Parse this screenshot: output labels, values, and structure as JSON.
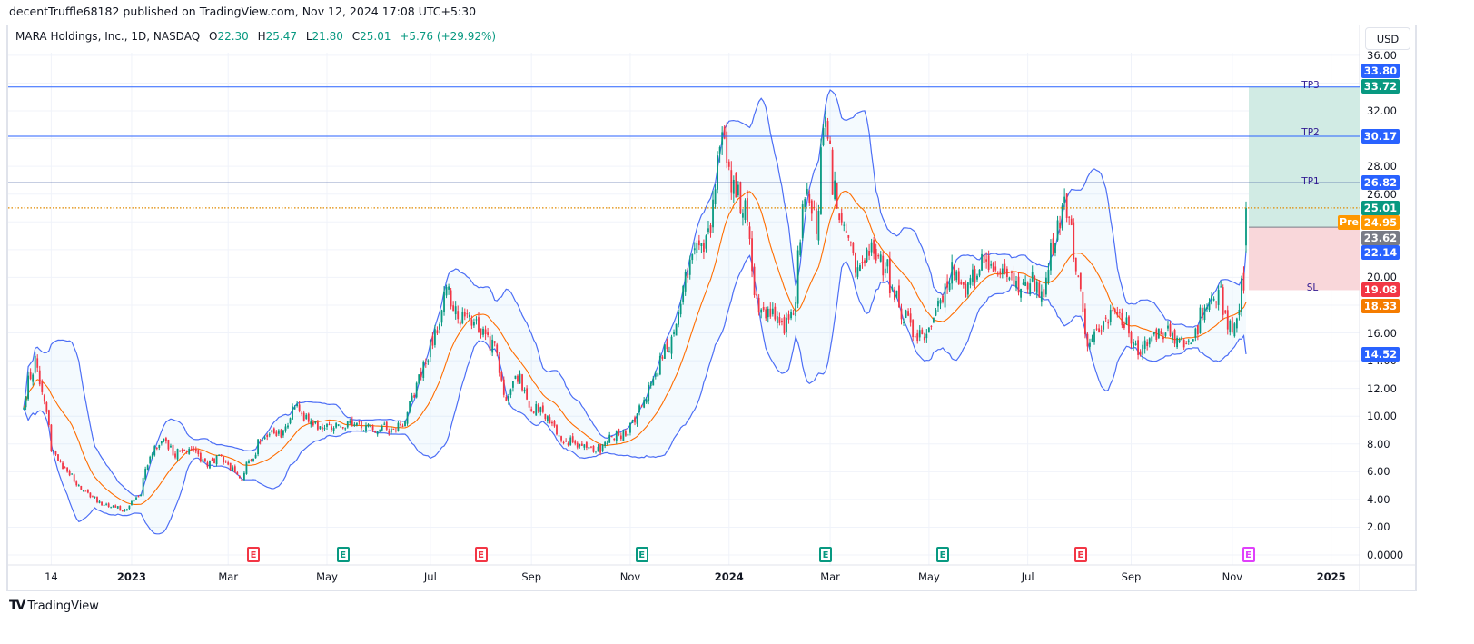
{
  "published": "decentTruffle68182 published on TradingView.com, Nov 12, 2024 17:08 UTC+5:30",
  "legend": {
    "symbol": "MARA Holdings, Inc., 1D, NASDAQ",
    "open_label": "O",
    "open": "22.30",
    "high_label": "H",
    "high": "25.47",
    "low_label": "L",
    "low": "21.80",
    "close_label": "C",
    "close": "25.01",
    "change": "+5.76 (+29.92%)"
  },
  "currency_button": "USD",
  "footer_logo": "TradingView",
  "colors": {
    "up": "#089981",
    "down": "#f23645",
    "bb_band": "#4c6ef5",
    "bb_basis": "#ff6d00",
    "target_zone": "#d1ebe4",
    "stop_zone": "#f9d7da",
    "level_line": "#2962ff"
  },
  "price_labels": [
    {
      "value": "33.80",
      "color": "#2962ff"
    },
    {
      "value": "33.72",
      "color": "#089981"
    },
    {
      "value": "30.17",
      "color": "#2962ff"
    },
    {
      "value": "26.82",
      "color": "#2962ff"
    },
    {
      "value": "25.01",
      "color": "#089981"
    },
    {
      "value": "24.95",
      "color": "#ff9800"
    },
    {
      "value": "23.62",
      "color": "#787b86"
    },
    {
      "value": "22.14",
      "color": "#2962ff"
    },
    {
      "value": "19.08",
      "color": "#f23645"
    },
    {
      "value": "18.33",
      "color": "#f57c00"
    },
    {
      "value": "14.52",
      "color": "#2962ff"
    }
  ],
  "pre_label": "Pre",
  "position_tool": {
    "entry": 23.62,
    "target": 33.72,
    "stop": 19.08,
    "stop_label": "SL"
  },
  "levels": [
    {
      "label": "TP3",
      "price": 33.72
    },
    {
      "label": "TP2",
      "price": 30.17
    },
    {
      "label": "TP1",
      "price": 26.82
    }
  ],
  "last_price_line": 25.01,
  "earnings": [
    {
      "label": "E",
      "date": "2023-03-16",
      "status": "miss"
    },
    {
      "label": "E",
      "date": "2023-05-10",
      "status": "beat"
    },
    {
      "label": "E",
      "date": "2023-08-02",
      "status": "miss"
    },
    {
      "label": "E",
      "date": "2023-11-08",
      "status": "beat"
    },
    {
      "label": "E",
      "date": "2024-02-28",
      "status": "beat"
    },
    {
      "label": "E",
      "date": "2024-05-09",
      "status": "beat"
    },
    {
      "label": "E",
      "date": "2024-08-01",
      "status": "miss"
    },
    {
      "label": "E",
      "date": "2024-11-12",
      "status": "upcoming"
    }
  ],
  "chart_data": {
    "type": "candlestick",
    "title": "MARA Holdings, Inc., 1D, NASDAQ",
    "indicators": [
      "Bollinger Bands (20, 2)"
    ],
    "y_axis": {
      "min": 0,
      "max": 36,
      "position": "right",
      "ticks": [
        "36.00",
        "32.00",
        "28.00",
        "26.00",
        "20.00",
        "16.00",
        "14.00",
        "12.00",
        "10.00",
        "8.00",
        "6.00",
        "4.00",
        "2.00",
        "0.0000"
      ]
    },
    "x_axis": {
      "ticks": [
        {
          "label": "14",
          "date": "2022-11-14"
        },
        {
          "label": "2023",
          "date": "2023-01-02"
        },
        {
          "label": "Mar",
          "date": "2023-03-01"
        },
        {
          "label": "May",
          "date": "2023-05-01"
        },
        {
          "label": "Jul",
          "date": "2023-07-03"
        },
        {
          "label": "Sep",
          "date": "2023-09-01"
        },
        {
          "label": "Nov",
          "date": "2023-11-01"
        },
        {
          "label": "2024",
          "date": "2024-01-01"
        },
        {
          "label": "Mar",
          "date": "2024-03-01"
        },
        {
          "label": "May",
          "date": "2024-05-01"
        },
        {
          "label": "Jul",
          "date": "2024-07-01"
        },
        {
          "label": "Sep",
          "date": "2024-09-02"
        },
        {
          "label": "Nov",
          "date": "2024-11-01"
        },
        {
          "label": "2025",
          "date": "2025-01-01"
        }
      ]
    },
    "grid": true,
    "approx_closes": [
      [
        "2022-10-27",
        10.5
      ],
      [
        "2022-11-03",
        14.0
      ],
      [
        "2022-11-08",
        11.5
      ],
      [
        "2022-11-14",
        7.5
      ],
      [
        "2022-11-22",
        6.2
      ],
      [
        "2022-12-01",
        4.8
      ],
      [
        "2022-12-12",
        3.8
      ],
      [
        "2022-12-28",
        3.2
      ],
      [
        "2023-01-06",
        4.5
      ],
      [
        "2023-01-13",
        7.5
      ],
      [
        "2023-01-20",
        8.3
      ],
      [
        "2023-01-27",
        7.3
      ],
      [
        "2023-02-06",
        7.8
      ],
      [
        "2023-02-16",
        6.5
      ],
      [
        "2023-02-24",
        7.0
      ],
      [
        "2023-03-09",
        5.5
      ],
      [
        "2023-03-16",
        7.2
      ],
      [
        "2023-03-23",
        8.8
      ],
      [
        "2023-04-03",
        8.6
      ],
      [
        "2023-04-12",
        11.0
      ],
      [
        "2023-04-19",
        9.5
      ],
      [
        "2023-04-27",
        9.2
      ],
      [
        "2023-05-10",
        9.4
      ],
      [
        "2023-05-25",
        9.2
      ],
      [
        "2023-06-07",
        9.1
      ],
      [
        "2023-06-15",
        9.4
      ],
      [
        "2023-06-23",
        12.0
      ],
      [
        "2023-07-03",
        15.0
      ],
      [
        "2023-07-12",
        19.0
      ],
      [
        "2023-07-20",
        17.0
      ],
      [
        "2023-08-01",
        16.5
      ],
      [
        "2023-08-10",
        15.0
      ],
      [
        "2023-08-17",
        11.0
      ],
      [
        "2023-08-25",
        13.0
      ],
      [
        "2023-08-31",
        10.7
      ],
      [
        "2023-09-08",
        10.3
      ],
      [
        "2023-09-20",
        8.5
      ],
      [
        "2023-10-02",
        7.8
      ],
      [
        "2023-10-12",
        7.5
      ],
      [
        "2023-10-20",
        8.5
      ],
      [
        "2023-10-30",
        8.8
      ],
      [
        "2023-11-08",
        11.0
      ],
      [
        "2023-11-16",
        13.0
      ],
      [
        "2023-11-27",
        16.0
      ],
      [
        "2023-12-05",
        20.0
      ],
      [
        "2023-12-14",
        22.5
      ],
      [
        "2023-12-20",
        24.0
      ],
      [
        "2023-12-27",
        30.0
      ],
      [
        "2024-01-03",
        26.0
      ],
      [
        "2024-01-10",
        25.0
      ],
      [
        "2024-01-17",
        18.0
      ],
      [
        "2024-01-24",
        17.5
      ],
      [
        "2024-02-01",
        16.5
      ],
      [
        "2024-02-08",
        17.0
      ],
      [
        "2024-02-15",
        26.0
      ],
      [
        "2024-02-22",
        24.0
      ],
      [
        "2024-02-28",
        31.0
      ],
      [
        "2024-03-05",
        26.0
      ],
      [
        "2024-03-12",
        23.0
      ],
      [
        "2024-03-19",
        20.0
      ],
      [
        "2024-03-28",
        22.0
      ],
      [
        "2024-04-05",
        20.5
      ],
      [
        "2024-04-15",
        17.5
      ],
      [
        "2024-04-22",
        16.0
      ],
      [
        "2024-04-30",
        15.5
      ],
      [
        "2024-05-08",
        18.5
      ],
      [
        "2024-05-17",
        21.0
      ],
      [
        "2024-05-24",
        19.0
      ],
      [
        "2024-06-03",
        21.5
      ],
      [
        "2024-06-14",
        20.0
      ],
      [
        "2024-06-25",
        19.5
      ],
      [
        "2024-07-03",
        20.0
      ],
      [
        "2024-07-10",
        18.8
      ],
      [
        "2024-07-18",
        23.5
      ],
      [
        "2024-07-22",
        25.5
      ],
      [
        "2024-07-30",
        21.0
      ],
      [
        "2024-08-05",
        15.5
      ],
      [
        "2024-08-12",
        16.0
      ],
      [
        "2024-08-23",
        17.8
      ],
      [
        "2024-09-03",
        15.5
      ],
      [
        "2024-09-06",
        14.0
      ],
      [
        "2024-09-13",
        15.8
      ],
      [
        "2024-09-24",
        16.0
      ],
      [
        "2024-10-01",
        15.3
      ],
      [
        "2024-10-10",
        16.0
      ],
      [
        "2024-10-18",
        18.5
      ],
      [
        "2024-10-25",
        19.0
      ],
      [
        "2024-11-01",
        16.0
      ],
      [
        "2024-11-05",
        17.0
      ],
      [
        "2024-11-07",
        19.3
      ],
      [
        "2024-11-08",
        19.2
      ],
      [
        "2024-11-11",
        25.01
      ]
    ],
    "last_bar": {
      "date": "2024-11-11",
      "open": 22.3,
      "high": 25.47,
      "low": 21.8,
      "close": 25.01
    }
  }
}
